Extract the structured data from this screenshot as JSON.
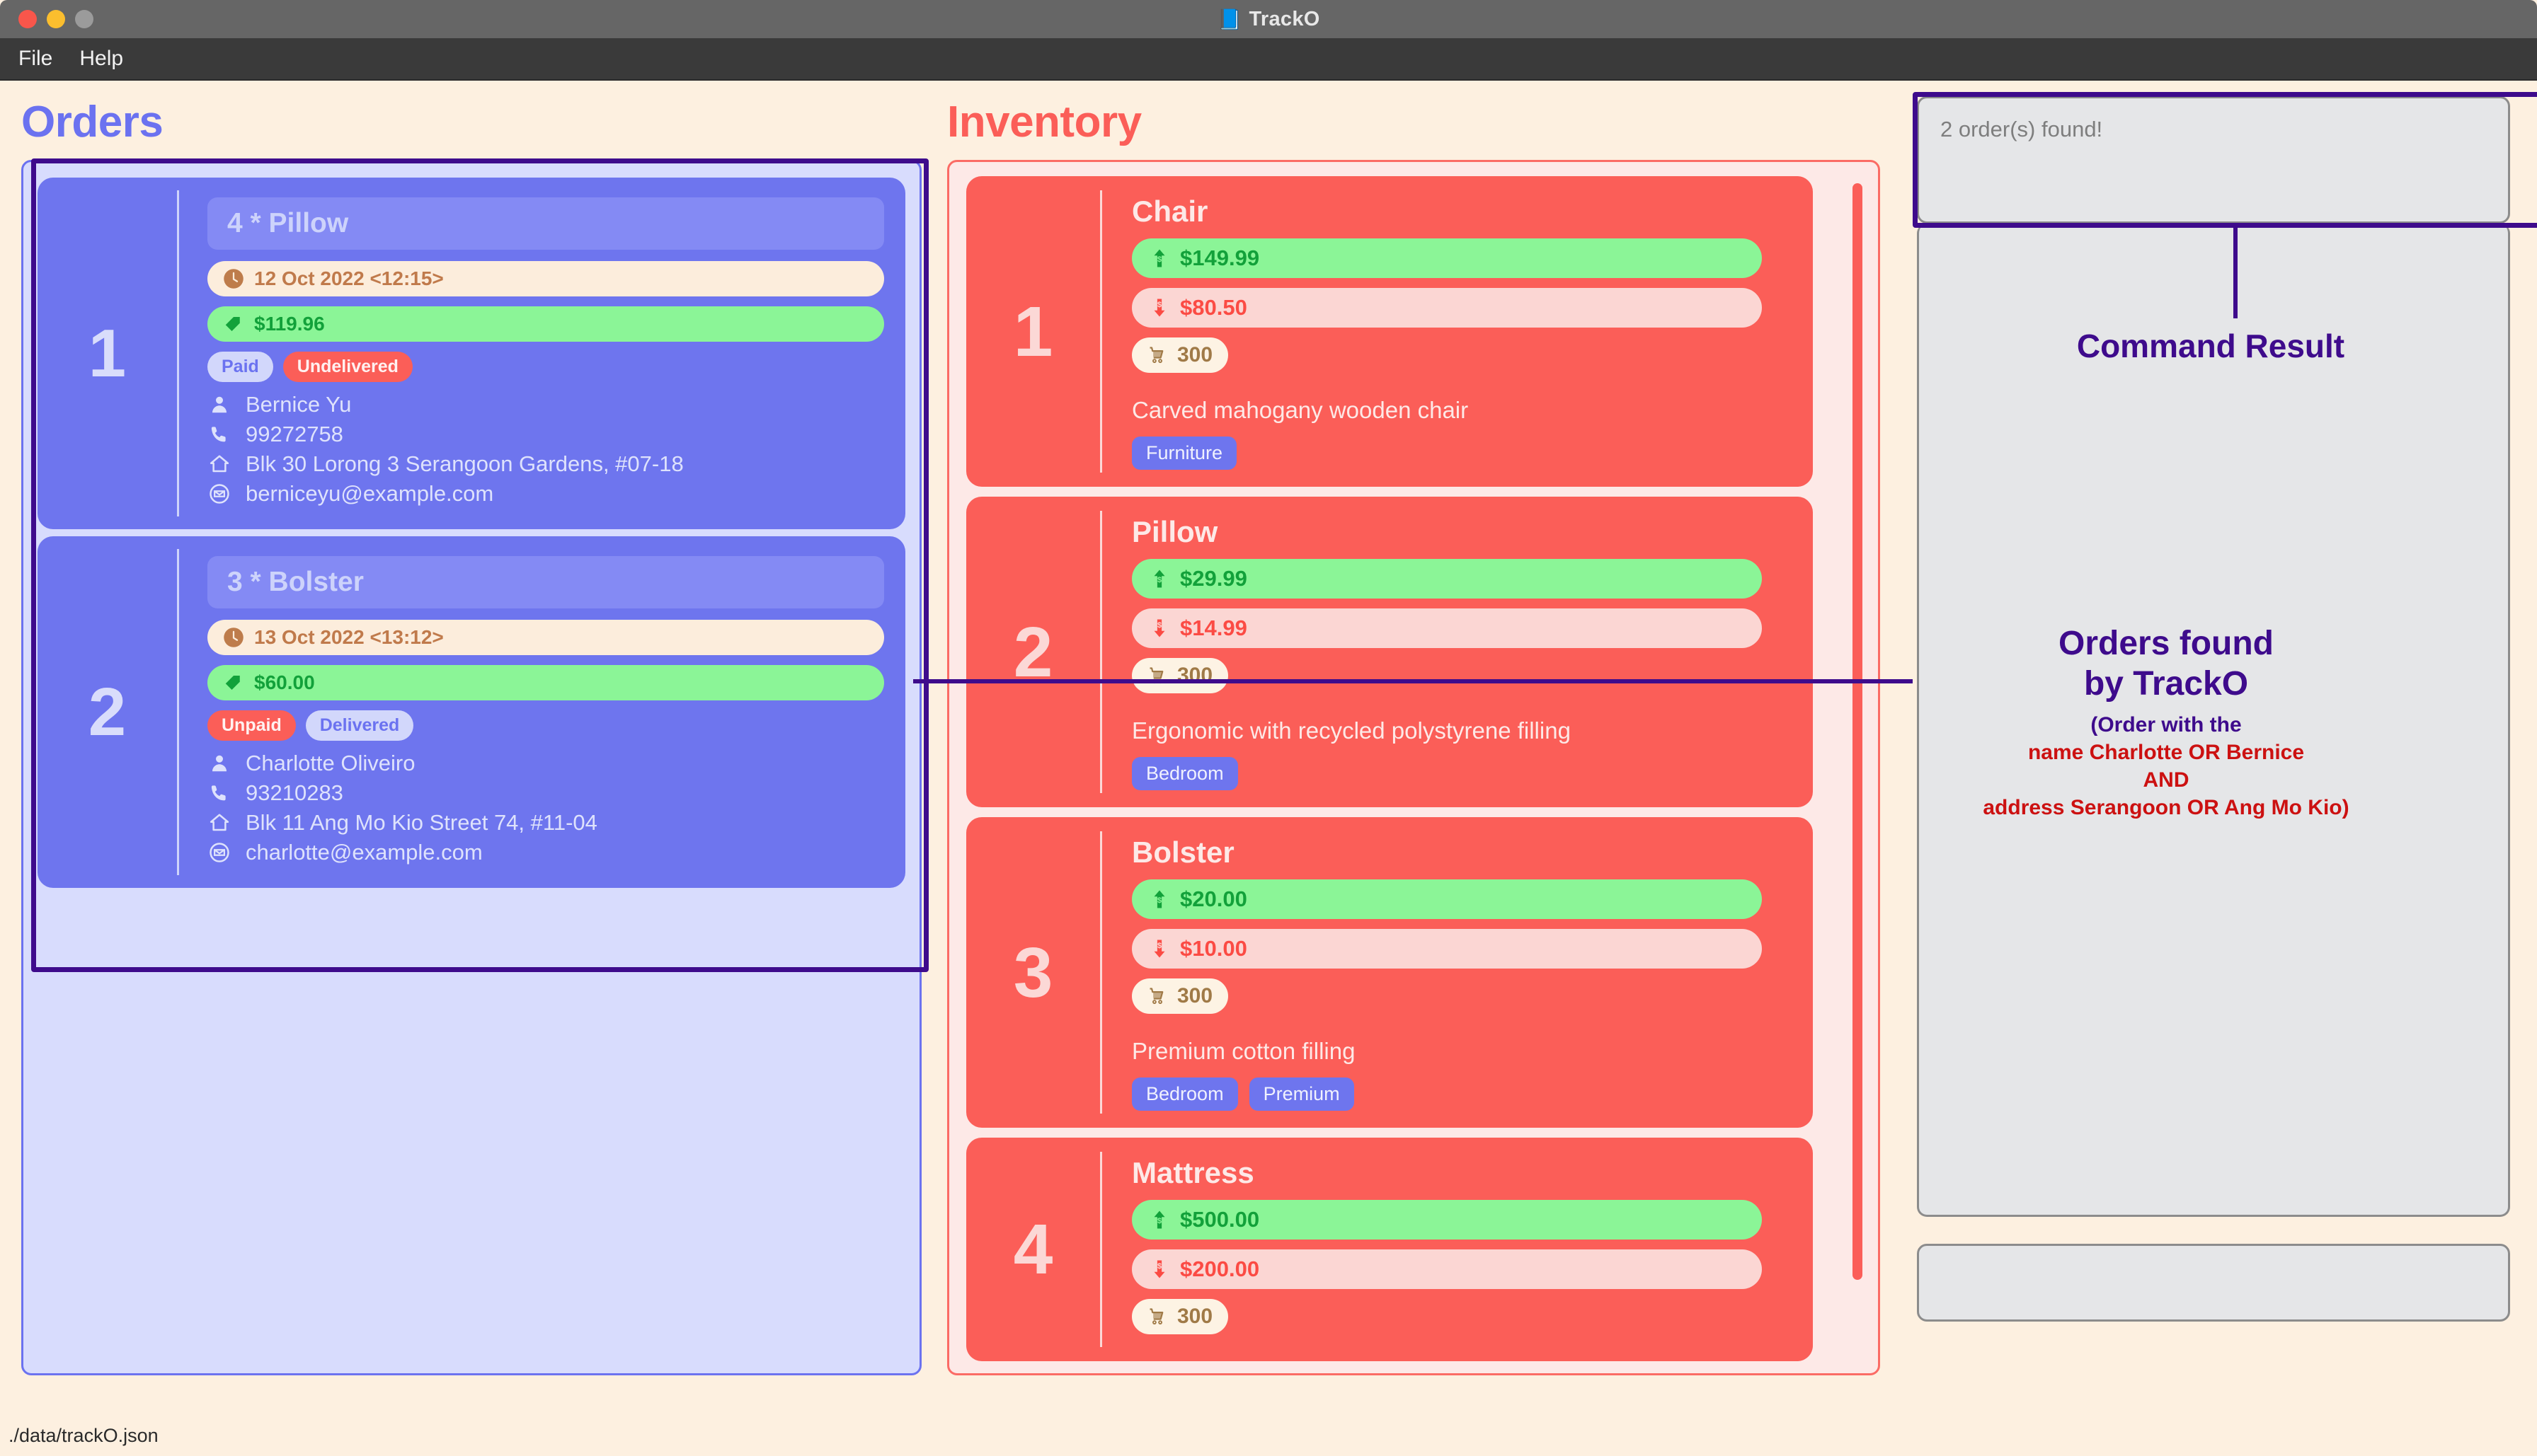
{
  "window": {
    "title": "TrackO",
    "title_icon": "blue-book-icon",
    "traffic_lights": [
      "close",
      "minimize",
      "maximize"
    ]
  },
  "menubar": {
    "items": [
      "File",
      "Help"
    ]
  },
  "orders_section": {
    "heading": "Orders",
    "orders": [
      {
        "index": "1",
        "title": "4 * Pillow",
        "date": "12 Oct 2022 <12:15>",
        "price": "$119.96",
        "payment_status": "Paid",
        "delivery_status": "Undelivered",
        "name": "Bernice Yu",
        "phone": "99272758",
        "address": "Blk 30 Lorong 3 Serangoon Gardens, #07-18",
        "email": "berniceyu@example.com"
      },
      {
        "index": "2",
        "title": "3 * Bolster",
        "date": "13 Oct 2022 <13:12>",
        "price": "$60.00",
        "payment_status": "Unpaid",
        "delivery_status": "Delivered",
        "name": "Charlotte Oliveiro",
        "phone": "93210283",
        "address": "Blk 11 Ang Mo Kio Street 74, #11-04",
        "email": "charlotte@example.com"
      }
    ]
  },
  "inventory_section": {
    "heading": "Inventory",
    "items": [
      {
        "index": "1",
        "name": "Chair",
        "sell_price": "$149.99",
        "cost_price": "$80.50",
        "quantity": "300",
        "description": "Carved mahogany wooden chair",
        "tags": [
          "Furniture"
        ]
      },
      {
        "index": "2",
        "name": "Pillow",
        "sell_price": "$29.99",
        "cost_price": "$14.99",
        "quantity": "300",
        "description": "Ergonomic with recycled polystyrene filling",
        "tags": [
          "Bedroom"
        ]
      },
      {
        "index": "3",
        "name": "Bolster",
        "sell_price": "$20.00",
        "cost_price": "$10.00",
        "quantity": "300",
        "description": "Premium cotton filling",
        "tags": [
          "Bedroom",
          "Premium"
        ]
      },
      {
        "index": "4",
        "name": "Mattress",
        "sell_price": "$500.00",
        "cost_price": "$200.00",
        "quantity": "300",
        "description": "",
        "tags": []
      }
    ]
  },
  "result_section": {
    "result_text": "2 order(s) found!",
    "command_input_value": ""
  },
  "annotations": {
    "command_result_label": "Command Result",
    "orders_found_line1": "Orders found",
    "orders_found_line2": "by TrackO",
    "detail_line1": "(Order with the",
    "detail_line2": "name Charlotte OR Bernice",
    "detail_line3": "AND",
    "detail_line4": "address Serangoon OR Ang Mo Kio)"
  },
  "statusbar": {
    "path": "./data/trackO.json"
  },
  "colors": {
    "orders_accent": "#6B72F0",
    "inventory_accent": "#FB5E58",
    "annotation_purple": "#3E0B8C",
    "annotation_red": "#CC1111",
    "page_background": "#FDF0E0",
    "price_green": "#8BF597",
    "date_cream": "#FCEDDC"
  }
}
